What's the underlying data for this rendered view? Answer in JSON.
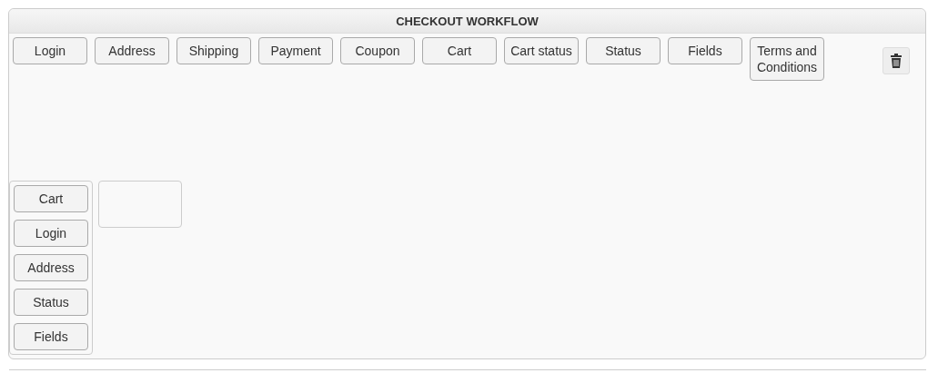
{
  "panel": {
    "title": "CHECKOUT WORKFLOW"
  },
  "palette": [
    {
      "label": "Login"
    },
    {
      "label": "Address"
    },
    {
      "label": "Shipping"
    },
    {
      "label": "Payment"
    },
    {
      "label": "Coupon"
    },
    {
      "label": "Cart"
    },
    {
      "label": "Cart status"
    },
    {
      "label": "Status"
    },
    {
      "label": "Fields"
    },
    {
      "label": "Terms and Conditions"
    }
  ],
  "columns": [
    {
      "items": [
        {
          "label": "Cart"
        },
        {
          "label": "Login"
        },
        {
          "label": "Address"
        },
        {
          "label": "Status"
        },
        {
          "label": "Fields"
        }
      ]
    },
    {
      "kind": "empty"
    }
  ]
}
